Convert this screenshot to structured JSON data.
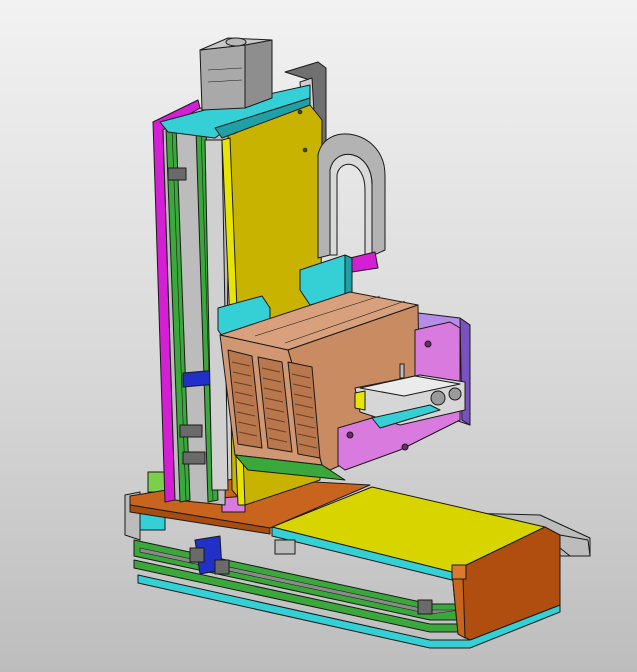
{
  "viewport": {
    "background_top": "#f2f2f2",
    "background_bottom": "#bdbdbd"
  },
  "colors": {
    "motor": "#a9a9a9",
    "cyan": "#35d0d5",
    "magenta": "#d41fd4",
    "olive": "#c8b400",
    "yellow": "#d8d400",
    "green": "#3aa83a",
    "brown": "#c98b62",
    "orange": "#c8641e",
    "violet": "#b58ce8",
    "pink": "#d97adf",
    "blue": "#2030c8",
    "dark_orange": "#b04e10",
    "light_green": "#7ad04a",
    "gray_part": "#bcbcbc"
  },
  "icons": {
    "stepper_motor": "stepper-motor-icon",
    "heatsink": "heatsink-icon",
    "cable_loop": "cable-loop-icon",
    "gripper": "pneumatic-gripper-icon"
  }
}
